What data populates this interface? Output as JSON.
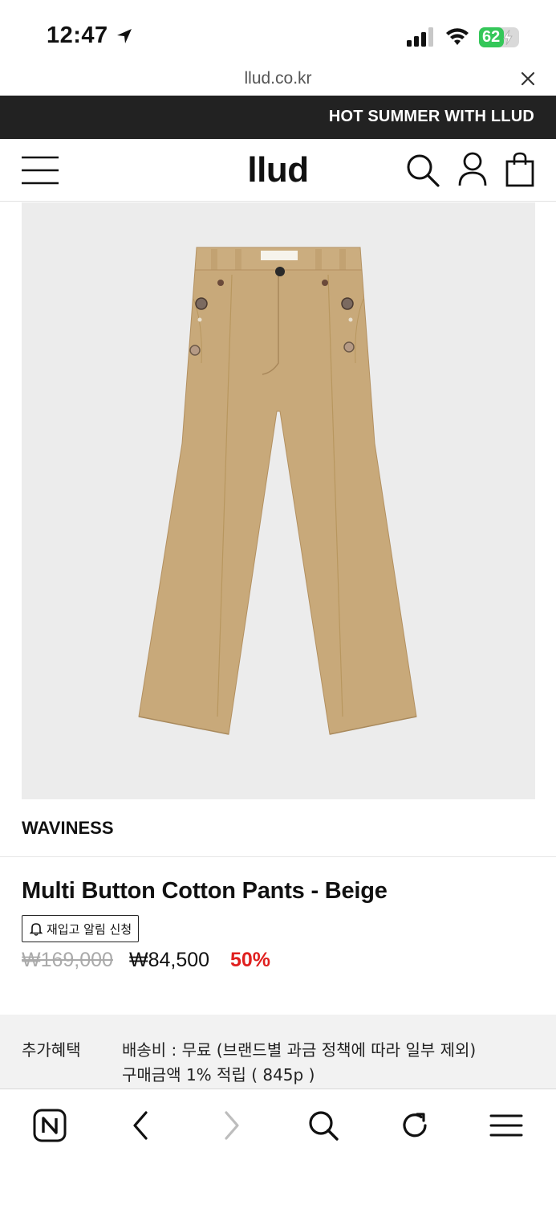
{
  "status_bar": {
    "time": "12:47",
    "battery": "62",
    "battery_level": 0.62
  },
  "browser": {
    "url": "llud.co.kr"
  },
  "announcement": {
    "text": "HOT SUMMER WITH LLUD"
  },
  "header": {
    "logo": "llud"
  },
  "product": {
    "brand": "WAVINESS",
    "name": "Multi Button Cotton Pants - Beige",
    "restock_label": "재입고 알림 신청",
    "original_price": "₩169,000",
    "sale_price": "₩84,500",
    "discount": "50%"
  },
  "benefits": {
    "label": "추가혜택",
    "lines": [
      "배송비 : 무료 (브랜드별 과금 정책에 따라 일부 제외)",
      "구매금액 1% 적립 ( 845p )"
    ]
  },
  "colors": {
    "announcement_bg": "#222222",
    "discount": "#e0201f",
    "battery": "#34c759",
    "image_bg": "#ececec",
    "pants": "#c8a97a"
  },
  "icons": [
    "location-arrow-icon",
    "signal-icon",
    "wifi-icon",
    "battery-icon",
    "close-icon",
    "menu-icon",
    "search-icon",
    "user-icon",
    "bag-icon",
    "bell-icon",
    "naver-icon",
    "back-icon",
    "forward-icon",
    "browser-search-icon",
    "refresh-icon",
    "browser-menu-icon"
  ]
}
